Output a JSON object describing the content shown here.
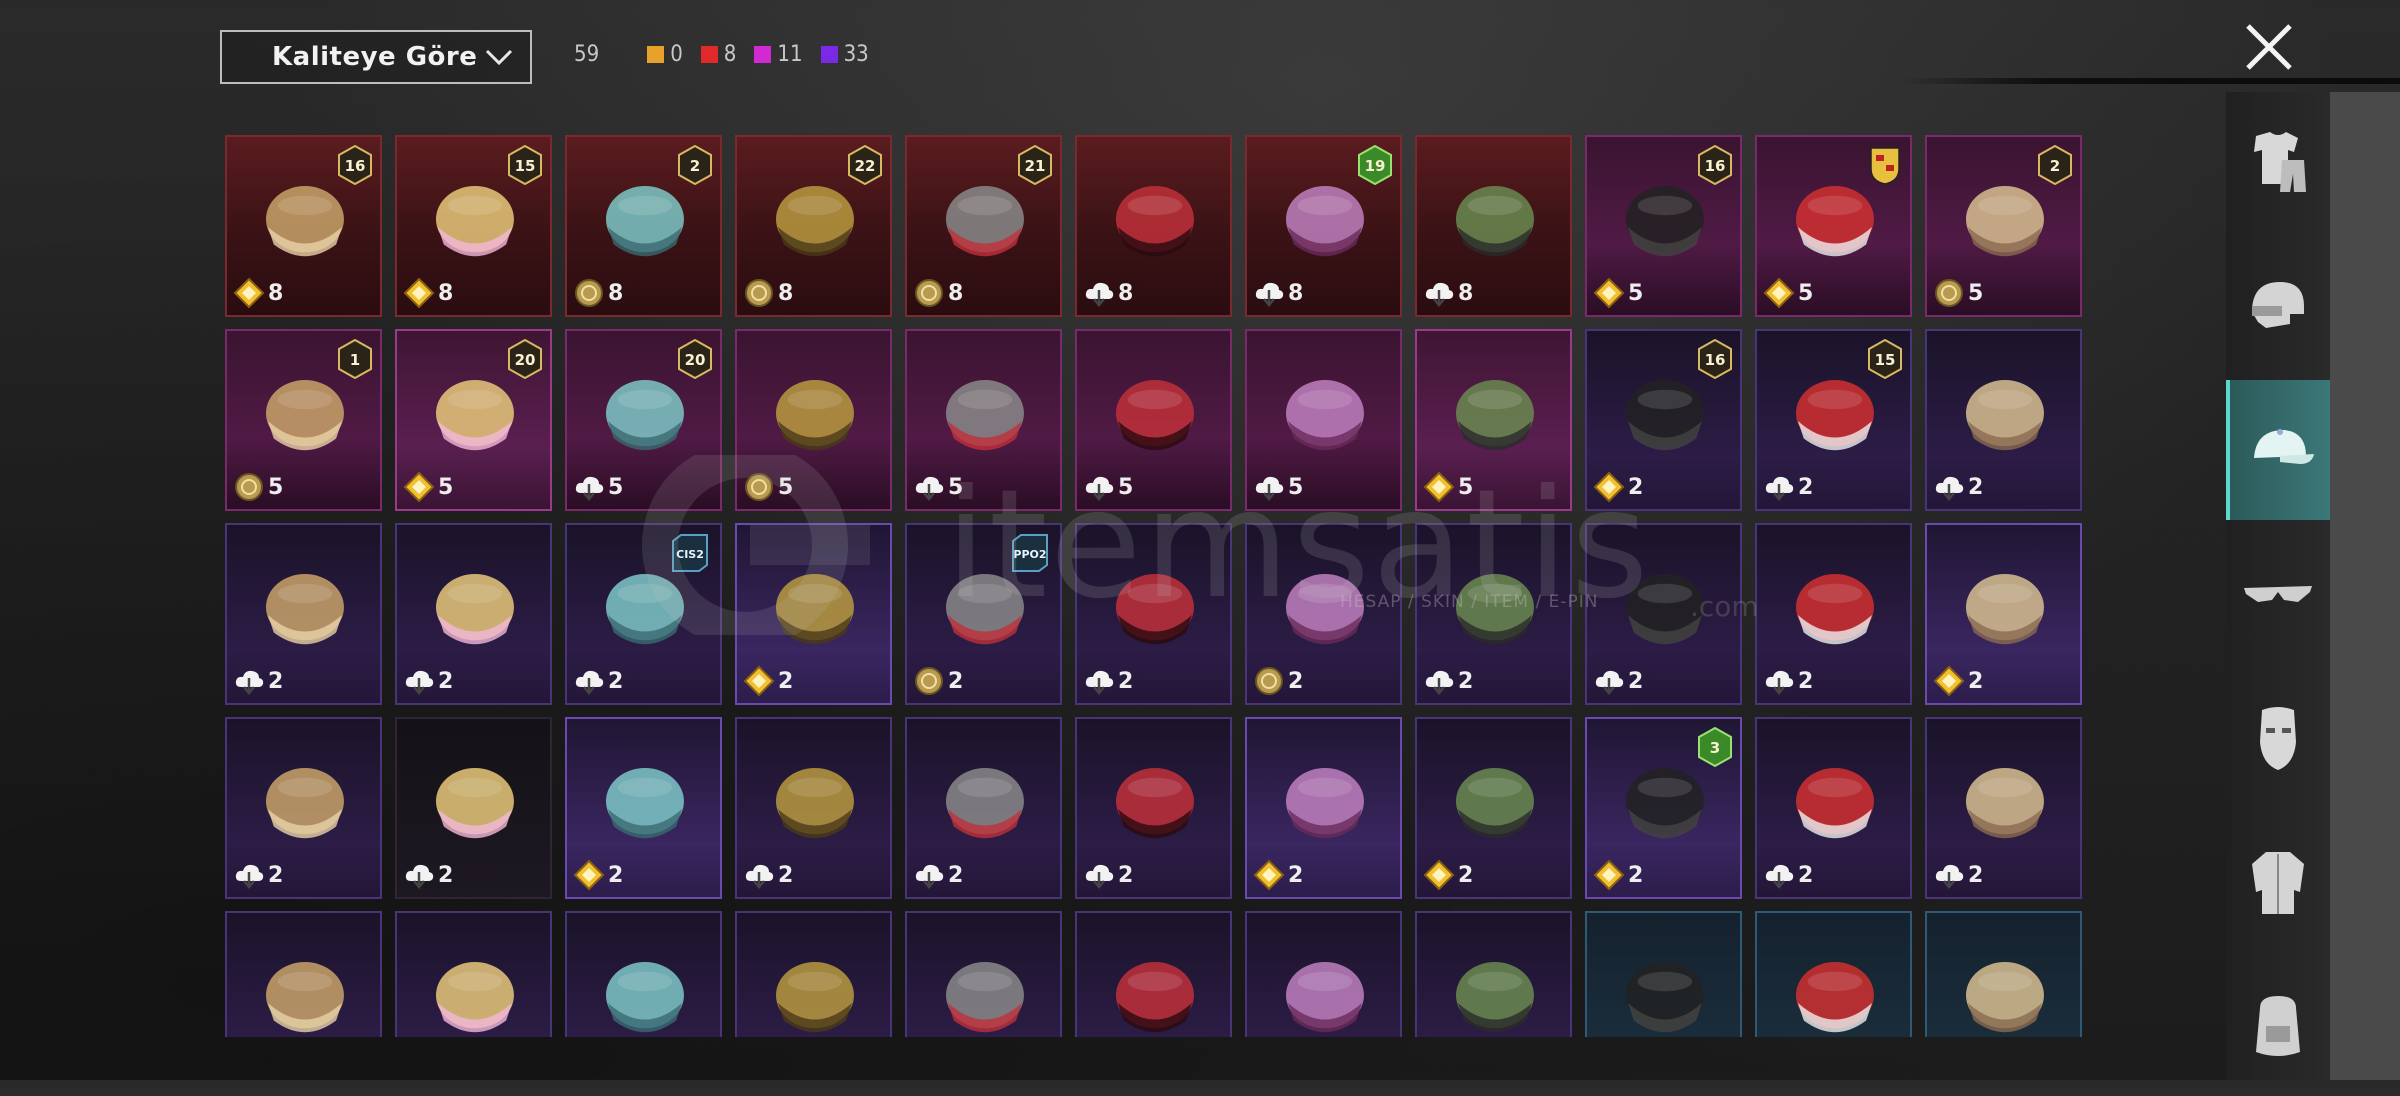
{
  "sort": {
    "label": "Kaliteye Göre"
  },
  "stats": {
    "total": "59",
    "counts": [
      {
        "value": "0",
        "color": "#e6a22a"
      },
      {
        "value": "8",
        "color": "#e02a2a"
      },
      {
        "value": "11",
        "color": "#d22ad2"
      },
      {
        "value": "33",
        "color": "#7a2ae6"
      }
    ]
  },
  "watermark": {
    "brand": "itemsatis",
    "tagline": "HESAP / SKIN / ITEM / E-PIN",
    "domain": ".com"
  },
  "sidebar": {
    "items": [
      {
        "icon": "outfit-icon",
        "active": false
      },
      {
        "icon": "headgear-icon",
        "active": false
      },
      {
        "icon": "hat-icon",
        "active": true
      },
      {
        "icon": "glasses-icon",
        "active": false
      },
      {
        "icon": "mask-icon",
        "active": false
      },
      {
        "icon": "jacket-icon",
        "active": false
      },
      {
        "icon": "backpack-icon",
        "active": false
      }
    ]
  },
  "items": [
    {
      "q": "red",
      "cur": "diamond",
      "count": "8",
      "badge": "16",
      "art": "goggle-hair"
    },
    {
      "q": "red",
      "cur": "diamond",
      "count": "8",
      "badge": "15",
      "art": "blonde-hair"
    },
    {
      "q": "red",
      "cur": "coin",
      "count": "8",
      "badge": "2",
      "art": "cyan-hood"
    },
    {
      "q": "red",
      "cur": "coin",
      "count": "8",
      "badge": "22",
      "art": "gold-helmet"
    },
    {
      "q": "red",
      "cur": "coin",
      "count": "8",
      "badge": "21",
      "art": "joker-mask"
    },
    {
      "q": "red",
      "cur": "cloud",
      "count": "8",
      "badge": "",
      "art": "oni-mask"
    },
    {
      "q": "red",
      "cur": "cloud",
      "count": "8",
      "badge": "19",
      "art": "horned-mask"
    },
    {
      "q": "red",
      "cur": "cloud",
      "count": "8",
      "badge": "",
      "art": "moto-helmet"
    },
    {
      "q": "pink",
      "cur": "diamond",
      "count": "5",
      "badge": "16",
      "art": "black-scarf"
    },
    {
      "q": "pink",
      "cur": "diamond",
      "count": "5",
      "badge": "porsche",
      "art": "race-helmet"
    },
    {
      "q": "pink",
      "cur": "coin",
      "count": "5",
      "badge": "2",
      "art": "bandana-hair"
    },
    {
      "q": "pink",
      "cur": "coin",
      "count": "5",
      "badge": "1",
      "art": "silver-hair"
    },
    {
      "q": "pinkb",
      "cur": "diamond",
      "count": "5",
      "badge": "20",
      "art": "bunny-hat"
    },
    {
      "q": "pink",
      "cur": "cloud",
      "count": "5",
      "badge": "20",
      "art": "gold-mask"
    },
    {
      "q": "pink",
      "cur": "coin",
      "count": "5",
      "badge": "",
      "art": "blue-demon"
    },
    {
      "q": "pink",
      "cur": "cloud",
      "count": "5",
      "badge": "",
      "art": "bow-hat"
    },
    {
      "q": "pink",
      "cur": "cloud",
      "count": "5",
      "badge": "",
      "art": "frog-hat"
    },
    {
      "q": "pink",
      "cur": "cloud",
      "count": "5",
      "badge": "",
      "art": "headband"
    },
    {
      "q": "pinkb",
      "cur": "diamond",
      "count": "5",
      "badge": "",
      "art": "white-hat"
    },
    {
      "q": "purple",
      "cur": "diamond",
      "count": "2",
      "badge": "16",
      "art": "ski-helmet"
    },
    {
      "q": "purple",
      "cur": "cloud",
      "count": "2",
      "badge": "15",
      "art": "red-hair"
    },
    {
      "q": "purple",
      "cur": "cloud",
      "count": "2",
      "badge": "",
      "art": "tactical-helmet"
    },
    {
      "q": "purple",
      "cur": "cloud",
      "count": "2",
      "badge": "",
      "art": "cat-ears"
    },
    {
      "q": "purple",
      "cur": "cloud",
      "count": "2",
      "badge": "",
      "art": "fez"
    },
    {
      "q": "purple",
      "cur": "cloud",
      "count": "2",
      "badge": "CIS2",
      "art": "red-bandana"
    },
    {
      "q": "purpleb",
      "cur": "diamond",
      "count": "2",
      "badge": "",
      "art": "sun-hat"
    },
    {
      "q": "purple",
      "cur": "coin",
      "count": "2",
      "badge": "PPO2",
      "art": "grey-bob"
    },
    {
      "q": "purple",
      "cur": "cloud",
      "count": "2",
      "badge": "",
      "art": "red-helmet"
    },
    {
      "q": "purple",
      "cur": "coin",
      "count": "2",
      "badge": "",
      "art": "braids"
    },
    {
      "q": "purple",
      "cur": "cloud",
      "count": "2",
      "badge": "",
      "art": "diver-mask"
    },
    {
      "q": "purple",
      "cur": "cloud",
      "count": "2",
      "badge": "",
      "art": "visor-helmet"
    },
    {
      "q": "purple",
      "cur": "cloud",
      "count": "2",
      "badge": "",
      "art": "top-hat"
    },
    {
      "q": "purpleb",
      "cur": "diamond",
      "count": "2",
      "badge": "",
      "art": "white-beanie"
    },
    {
      "q": "purple",
      "cur": "cloud",
      "count": "2",
      "badge": "",
      "art": "pompom-hat"
    },
    {
      "q": "dark",
      "cur": "cloud",
      "count": "2",
      "badge": "",
      "art": "black-cap"
    },
    {
      "q": "purpleb",
      "cur": "diamond",
      "count": "2",
      "badge": "",
      "art": "wrestler-mask"
    },
    {
      "q": "purple",
      "cur": "cloud",
      "count": "2",
      "badge": "",
      "art": "beret"
    },
    {
      "q": "purple",
      "cur": "cloud",
      "count": "2",
      "badge": "",
      "art": "fedora-red"
    },
    {
      "q": "purple",
      "cur": "cloud",
      "count": "2",
      "badge": "",
      "art": "shark-hat"
    },
    {
      "q": "purpleb",
      "cur": "diamond",
      "count": "2",
      "badge": "",
      "art": "flower-crown"
    },
    {
      "q": "purple",
      "cur": "diamond",
      "count": "2",
      "badge": "",
      "art": "red-bucket"
    },
    {
      "q": "purpleb",
      "cur": "diamond",
      "count": "2",
      "badge": "3",
      "art": "black-fedora"
    },
    {
      "q": "purple",
      "cur": "cloud",
      "count": "2",
      "badge": "",
      "art": "knit-hat"
    },
    {
      "q": "purple",
      "cur": "cloud",
      "count": "2",
      "badge": "",
      "art": "burger-hat"
    },
    {
      "q": "purple",
      "cur": "",
      "count": "",
      "badge": "",
      "art": "headlamp"
    },
    {
      "q": "purple",
      "cur": "",
      "count": "",
      "badge": "",
      "art": "blue-cap"
    },
    {
      "q": "purple",
      "cur": "",
      "count": "",
      "badge": "",
      "art": "pink-cap"
    },
    {
      "q": "purple",
      "cur": "",
      "count": "",
      "badge": "",
      "art": "red-fedora"
    },
    {
      "q": "purple",
      "cur": "",
      "count": "",
      "badge": "",
      "art": "net-helmet"
    },
    {
      "q": "purple",
      "cur": "",
      "count": "",
      "badge": "",
      "art": "bucket-hat"
    },
    {
      "q": "purple",
      "cur": "",
      "count": "",
      "badge": "",
      "art": "pilot-cap"
    },
    {
      "q": "purple",
      "cur": "",
      "count": "",
      "badge": "",
      "art": "camo-hat"
    },
    {
      "q": "blue",
      "cur": "",
      "count": "",
      "badge": "",
      "art": "blue-beret"
    },
    {
      "q": "blue",
      "cur": "",
      "count": "",
      "badge": "",
      "art": "grey-beret"
    },
    {
      "q": "blue",
      "cur": "",
      "count": "",
      "badge": "",
      "art": "trucker-cap"
    }
  ]
}
